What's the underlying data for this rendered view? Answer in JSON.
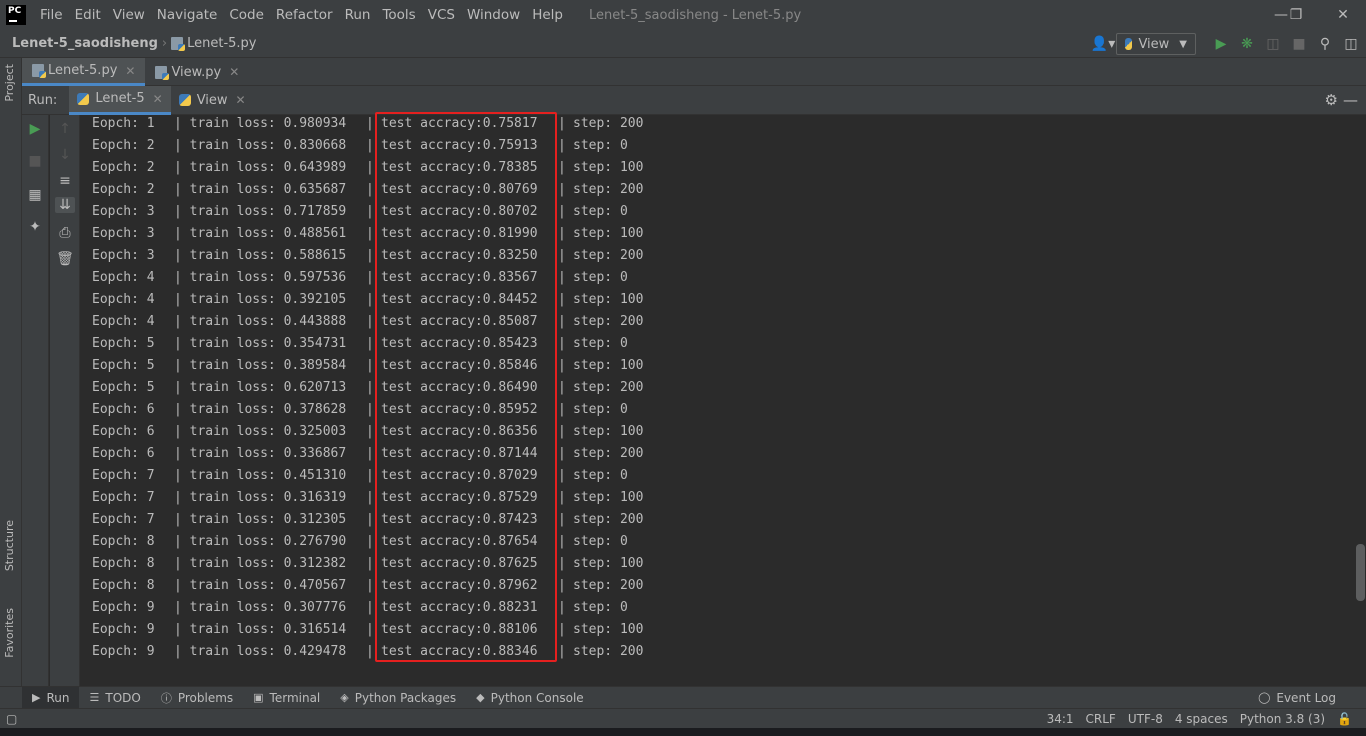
{
  "titlebar": {
    "logo": "PC",
    "menu": [
      "File",
      "Edit",
      "View",
      "Navigate",
      "Code",
      "Refactor",
      "Run",
      "Tools",
      "VCS",
      "Window",
      "Help"
    ],
    "title": "Lenet-5_saodisheng - Lenet-5.py",
    "controls": [
      "—",
      "❐",
      "✕"
    ]
  },
  "navbar": {
    "project": "Lenet-5_saodisheng",
    "file": "Lenet-5.py",
    "run_config": "View"
  },
  "editor_tabs": [
    {
      "label": "Lenet-5.py",
      "active": true
    },
    {
      "label": "View.py",
      "active": false
    }
  ],
  "run_panel": {
    "label": "Run:",
    "tabs": [
      {
        "label": "Lenet-5",
        "active": true
      },
      {
        "label": "View",
        "active": false
      }
    ]
  },
  "left_stripe": {
    "project": "Project",
    "structure": "Structure",
    "favorites": "Favorites"
  },
  "console": {
    "lines": [
      {
        "epoch": "Eopch: 1",
        "loss": "| train loss: 0.980934",
        "acc": "test accracy:0.75817",
        "step": "step: 200"
      },
      {
        "epoch": "Eopch: 2",
        "loss": "| train loss: 0.830668",
        "acc": "test accracy:0.75913",
        "step": "step: 0"
      },
      {
        "epoch": "Eopch: 2",
        "loss": "| train loss: 0.643989",
        "acc": "test accracy:0.78385",
        "step": "step: 100"
      },
      {
        "epoch": "Eopch: 2",
        "loss": "| train loss: 0.635687",
        "acc": "test accracy:0.80769",
        "step": "step: 200"
      },
      {
        "epoch": "Eopch: 3",
        "loss": "| train loss: 0.717859",
        "acc": "test accracy:0.80702",
        "step": "step: 0"
      },
      {
        "epoch": "Eopch: 3",
        "loss": "| train loss: 0.488561",
        "acc": "test accracy:0.81990",
        "step": "step: 100"
      },
      {
        "epoch": "Eopch: 3",
        "loss": "| train loss: 0.588615",
        "acc": "test accracy:0.83250",
        "step": "step: 200"
      },
      {
        "epoch": "Eopch: 4",
        "loss": "| train loss: 0.597536",
        "acc": "test accracy:0.83567",
        "step": "step: 0"
      },
      {
        "epoch": "Eopch: 4",
        "loss": "| train loss: 0.392105",
        "acc": "test accracy:0.84452",
        "step": "step: 100"
      },
      {
        "epoch": "Eopch: 4",
        "loss": "| train loss: 0.443888",
        "acc": "test accracy:0.85087",
        "step": "step: 200"
      },
      {
        "epoch": "Eopch: 5",
        "loss": "| train loss: 0.354731",
        "acc": "test accracy:0.85423",
        "step": "step: 0"
      },
      {
        "epoch": "Eopch: 5",
        "loss": "| train loss: 0.389584",
        "acc": "test accracy:0.85846",
        "step": "step: 100"
      },
      {
        "epoch": "Eopch: 5",
        "loss": "| train loss: 0.620713",
        "acc": "test accracy:0.86490",
        "step": "step: 200"
      },
      {
        "epoch": "Eopch: 6",
        "loss": "| train loss: 0.378628",
        "acc": "test accracy:0.85952",
        "step": "step: 0"
      },
      {
        "epoch": "Eopch: 6",
        "loss": "| train loss: 0.325003",
        "acc": "test accracy:0.86356",
        "step": "step: 100"
      },
      {
        "epoch": "Eopch: 6",
        "loss": "| train loss: 0.336867",
        "acc": "test accracy:0.87144",
        "step": "step: 200"
      },
      {
        "epoch": "Eopch: 7",
        "loss": "| train loss: 0.451310",
        "acc": "test accracy:0.87029",
        "step": "step: 0"
      },
      {
        "epoch": "Eopch: 7",
        "loss": "| train loss: 0.316319",
        "acc": "test accracy:0.87529",
        "step": "step: 100"
      },
      {
        "epoch": "Eopch: 7",
        "loss": "| train loss: 0.312305",
        "acc": "test accracy:0.87423",
        "step": "step: 200"
      },
      {
        "epoch": "Eopch: 8",
        "loss": "| train loss: 0.276790",
        "acc": "test accracy:0.87654",
        "step": "step: 0"
      },
      {
        "epoch": "Eopch: 8",
        "loss": "| train loss: 0.312382",
        "acc": "test accracy:0.87625",
        "step": "step: 100"
      },
      {
        "epoch": "Eopch: 8",
        "loss": "| train loss: 0.470567",
        "acc": "test accracy:0.87962",
        "step": "step: 200"
      },
      {
        "epoch": "Eopch: 9",
        "loss": "| train loss: 0.307776",
        "acc": "test accracy:0.88231",
        "step": "step: 0"
      },
      {
        "epoch": "Eopch: 9",
        "loss": "| train loss: 0.316514",
        "acc": "test accracy:0.88106",
        "step": "step: 100"
      },
      {
        "epoch": "Eopch: 9",
        "loss": "| train loss: 0.429478",
        "acc": "test accracy:0.88346",
        "step": "step: 200"
      }
    ]
  },
  "bottom_tabs": [
    {
      "label": "Run",
      "icon": "run-icon",
      "active": true
    },
    {
      "label": "TODO",
      "icon": "todo-icon",
      "active": false
    },
    {
      "label": "Problems",
      "icon": "problems-icon",
      "active": false
    },
    {
      "label": "Terminal",
      "icon": "terminal-icon",
      "active": false
    },
    {
      "label": "Python Packages",
      "icon": "packages-icon",
      "active": false
    },
    {
      "label": "Python Console",
      "icon": "python-console-icon",
      "active": false
    }
  ],
  "event_log": "Event Log",
  "status": {
    "position": "34:1",
    "line_sep": "CRLF",
    "encoding": "UTF-8",
    "indent": "4 spaces",
    "interpreter": "Python 3.8 (3)"
  },
  "colors": {
    "highlight_border": "#e5201f",
    "accent": "#4a88c7",
    "run_green": "#499c54"
  }
}
